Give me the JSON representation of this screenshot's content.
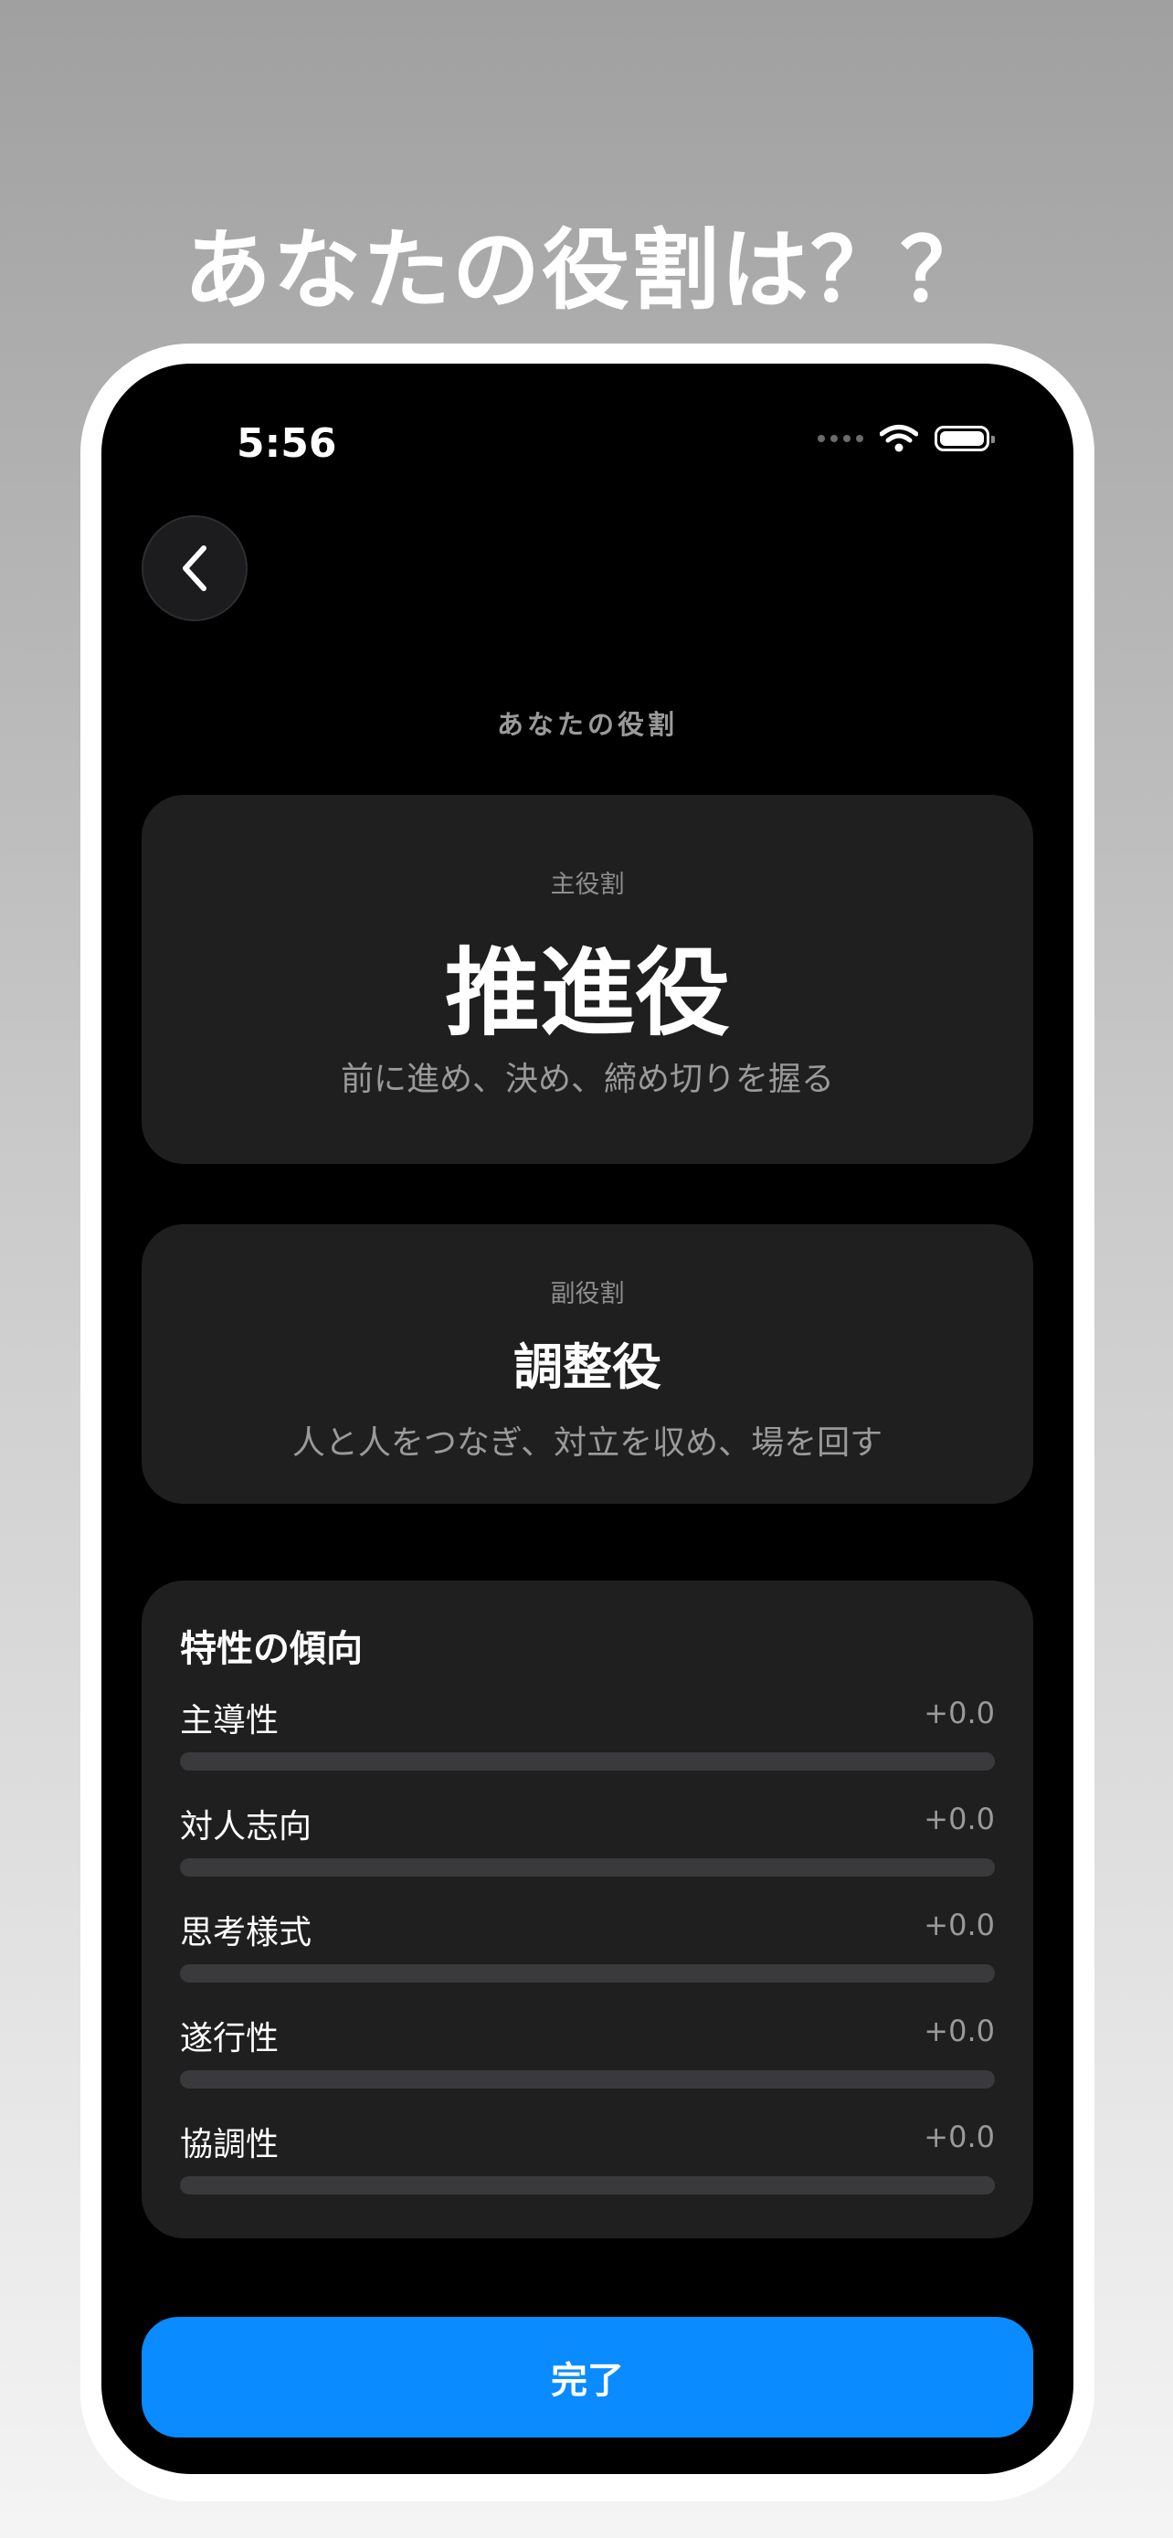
{
  "headline": "あなたの役割は？？",
  "status_bar": {
    "time": "5:56"
  },
  "section_caption": "あなたの役割",
  "primary_role": {
    "label": "主役割",
    "name": "推進役",
    "description": "前に進め、決め、締め切りを握る"
  },
  "secondary_role": {
    "label": "副役割",
    "name": "調整役",
    "description": "人と人をつなぎ、対立を収め、場を回す"
  },
  "traits": {
    "title": "特性の傾向",
    "items": [
      {
        "name": "主導性",
        "value": "+0.0",
        "level": 0
      },
      {
        "name": "対人志向",
        "value": "+0.0",
        "level": 0
      },
      {
        "name": "思考様式",
        "value": "+0.0",
        "level": 0
      },
      {
        "name": "遂行性",
        "value": "+0.0",
        "level": 0
      },
      {
        "name": "協調性",
        "value": "+0.0",
        "level": 0
      }
    ]
  },
  "done_button": {
    "label": "完了"
  },
  "colors": {
    "accent": "#0a8bff",
    "card": "#1f1f1f",
    "background": "#000000"
  }
}
